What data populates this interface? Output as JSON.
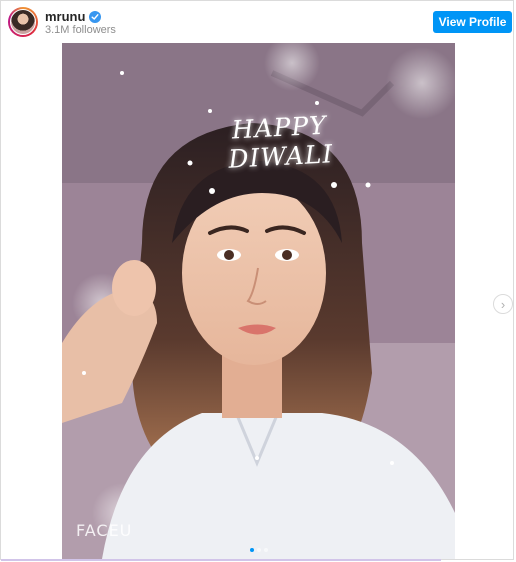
{
  "header": {
    "username": "mrunu",
    "followers": "3.1M followers",
    "view_profile_label": "View Profile"
  },
  "post": {
    "overlay_text": "HAPPY DIWALI",
    "watermark": "FACEU",
    "carousel": {
      "total_dots": 3,
      "active_index": 0
    }
  },
  "icons": {
    "verified": "verified-badge-icon",
    "next": "chevron-right-icon"
  },
  "colors": {
    "accent": "#0095f6",
    "verified": "#3897f0"
  }
}
